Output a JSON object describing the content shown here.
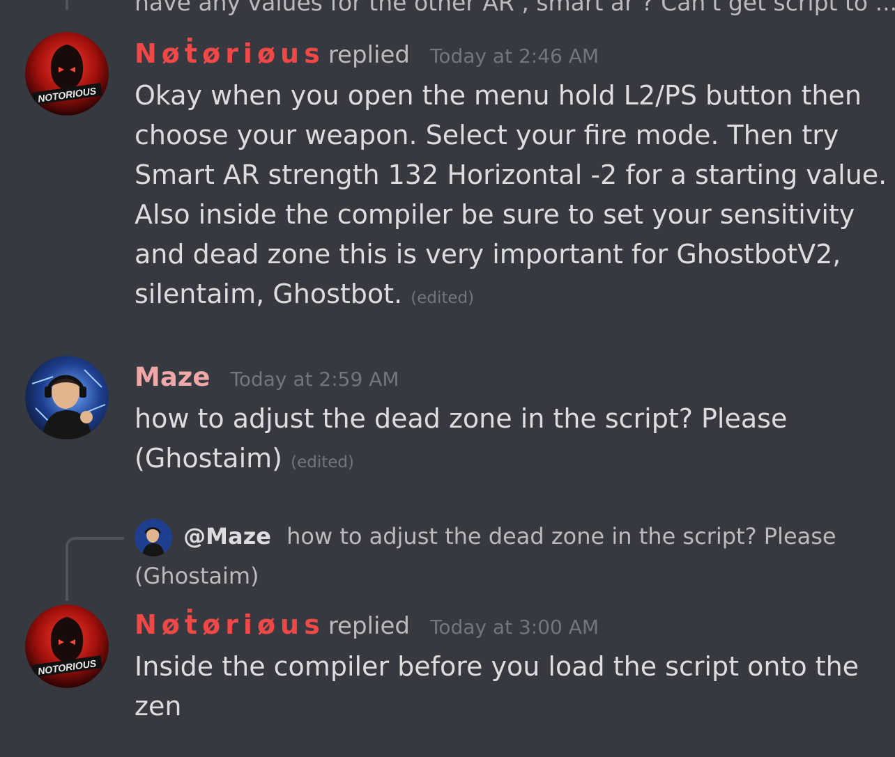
{
  "top_snippet": "have any values for the other AR , smart ar ? Can't get script to ...",
  "messages": [
    {
      "author": "Nøṫøriøus",
      "replied": "replied",
      "timestamp": "Today at 2:46 AM",
      "lines": [
        "Okay when you open the menu hold L2/PS button then",
        "choose your weapon. Select your fire mode. Then try",
        "Smart AR strength 132 Horizontal -2 for a starting value.",
        "Also inside the compiler be sure to set your sensitivity",
        "and dead zone this is very important for GhostbotV2,",
        "silentaim, Ghostbot."
      ],
      "edited": "(edited)",
      "avatar_text": "NOTORIOUS"
    },
    {
      "author": "Maze",
      "timestamp": "Today at 2:59 AM",
      "lines": [
        "how to adjust the dead zone in the script? Please",
        "(Ghostaim)"
      ],
      "edited": "(edited)"
    },
    {
      "reply_to": {
        "mention": "@Maze",
        "snippet": "how to adjust the dead zone in the script? Please",
        "snippet_wrap": "(Ghostaim)"
      },
      "author": "Nøṫøriøus",
      "replied": "replied",
      "timestamp": "Today at 3:00 AM",
      "lines": [
        "Inside the compiler before you load the script onto the",
        "zen"
      ],
      "avatar_text": "NOTORIOUS"
    }
  ],
  "colors": {
    "background": "#36393f",
    "notorious_name": "#f04747",
    "maze_name": "#f0a7a7",
    "text": "#dcddde",
    "muted": "#72767d"
  }
}
